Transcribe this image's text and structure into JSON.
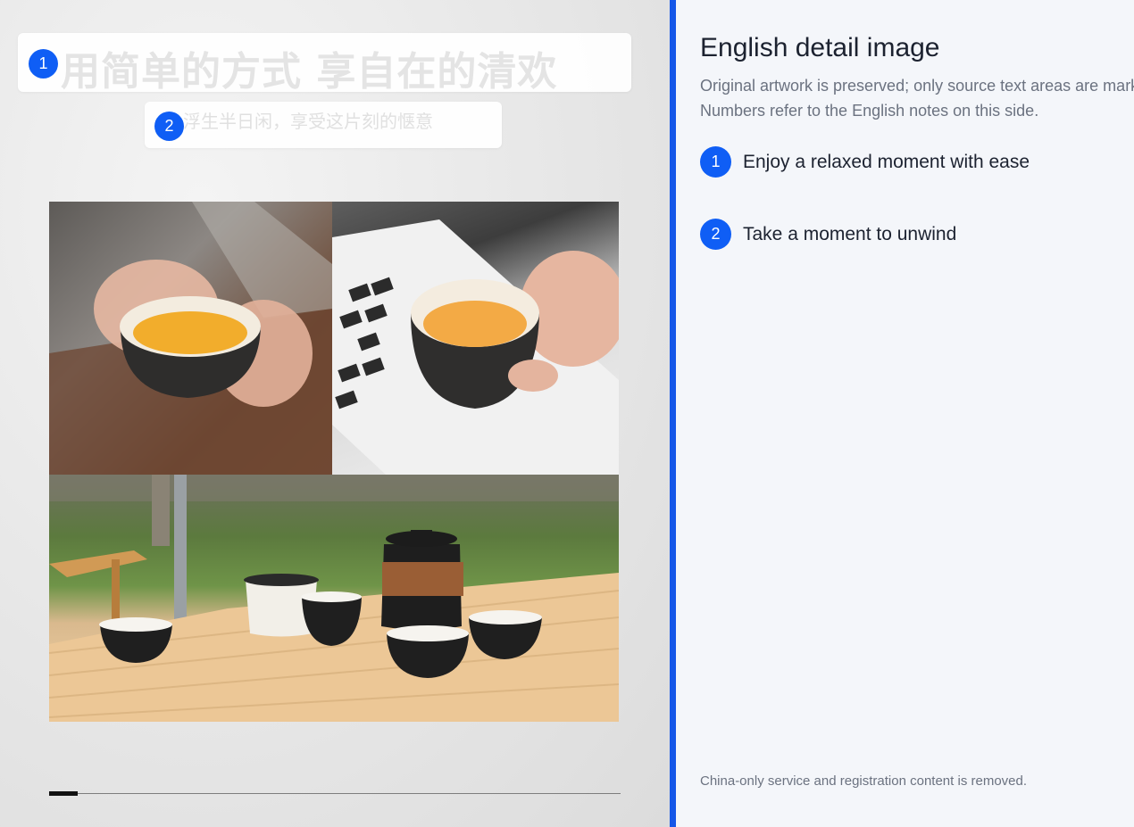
{
  "artwork": {
    "source_text_1": "用简单的方式 享自在的清欢",
    "source_text_2": "浮生半日闲，享受这片刻的惬意",
    "markers": [
      "1",
      "2"
    ],
    "carousel_progress": 0.05
  },
  "notes": {
    "title": "English detail image",
    "subtitle_line_1": "Original artwork is preserved; only source text areas are marked.",
    "subtitle_line_2": "Numbers refer to the English notes on this side.",
    "items": [
      {
        "number": "1",
        "text": "Enjoy a relaxed moment with ease"
      },
      {
        "number": "2",
        "text": "Take a moment to unwind"
      }
    ],
    "footer": "China-only service and registration content is removed."
  },
  "colors": {
    "accent": "#0f5ef5",
    "divider": "#1557e8",
    "panel_bg": "#f4f6fa",
    "title_text": "#1c2230",
    "muted_text": "#6b7280"
  }
}
